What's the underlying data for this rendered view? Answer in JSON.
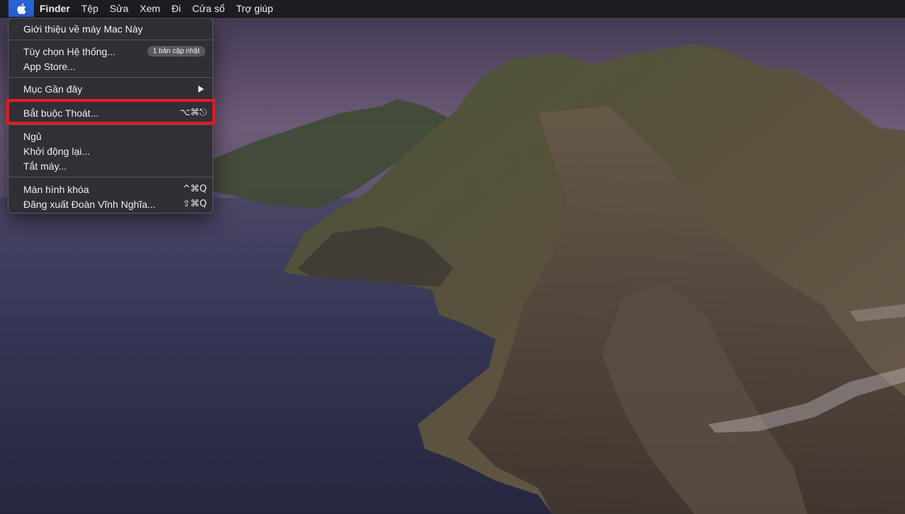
{
  "menubar": {
    "apple_icon": "apple-logo-icon",
    "items": [
      "Finder",
      "Tệp",
      "Sửa",
      "Xem",
      "Đi",
      "Cửa sổ",
      "Trợ giúp"
    ]
  },
  "apple_menu": {
    "about": "Giới thiệu về máy Mac Này",
    "system_prefs": "Tùy chọn Hệ thống...",
    "system_prefs_badge": "1 bản cập nhật",
    "app_store": "App Store...",
    "recent_items": "Mục Gần đây",
    "force_quit": "Bắt buộc Thoát...",
    "force_quit_shortcut": "⌥⌘⎋",
    "sleep": "Ngủ",
    "restart": "Khởi động lại...",
    "shutdown": "Tắt máy...",
    "lock_screen": "Màn hình khóa",
    "lock_screen_shortcut": "^⌘Q",
    "logout": "Đăng xuất Đoàn Vĩnh Nghĩa...",
    "logout_shortcut": "⇧⌘Q"
  },
  "colors": {
    "highlight": "#e31b23",
    "apple_menu_active": "#2b63d6"
  }
}
